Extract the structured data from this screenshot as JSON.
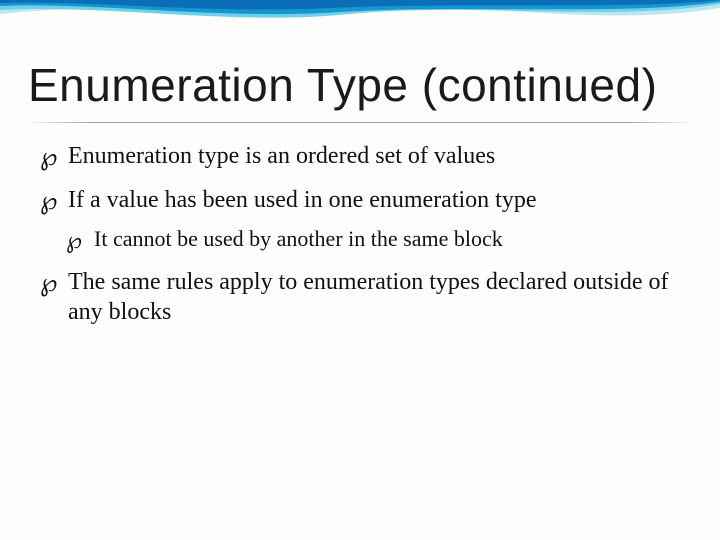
{
  "slide": {
    "title": "Enumeration Type (continued)",
    "bullets": [
      {
        "level": 1,
        "text": "Enumeration type is an ordered set of values"
      },
      {
        "level": 1,
        "text": "If a value has been used in one enumeration type"
      },
      {
        "level": 2,
        "text": "It cannot be used by another in the same block"
      },
      {
        "level": 1,
        "text": "The same rules apply to enumeration types declared outside of any blocks"
      }
    ],
    "bullet_glyph": "℘"
  },
  "theme": {
    "wave_colors": [
      "#0b6fb8",
      "#1596d1",
      "#6fd0e8",
      "#b9e8f3"
    ]
  }
}
